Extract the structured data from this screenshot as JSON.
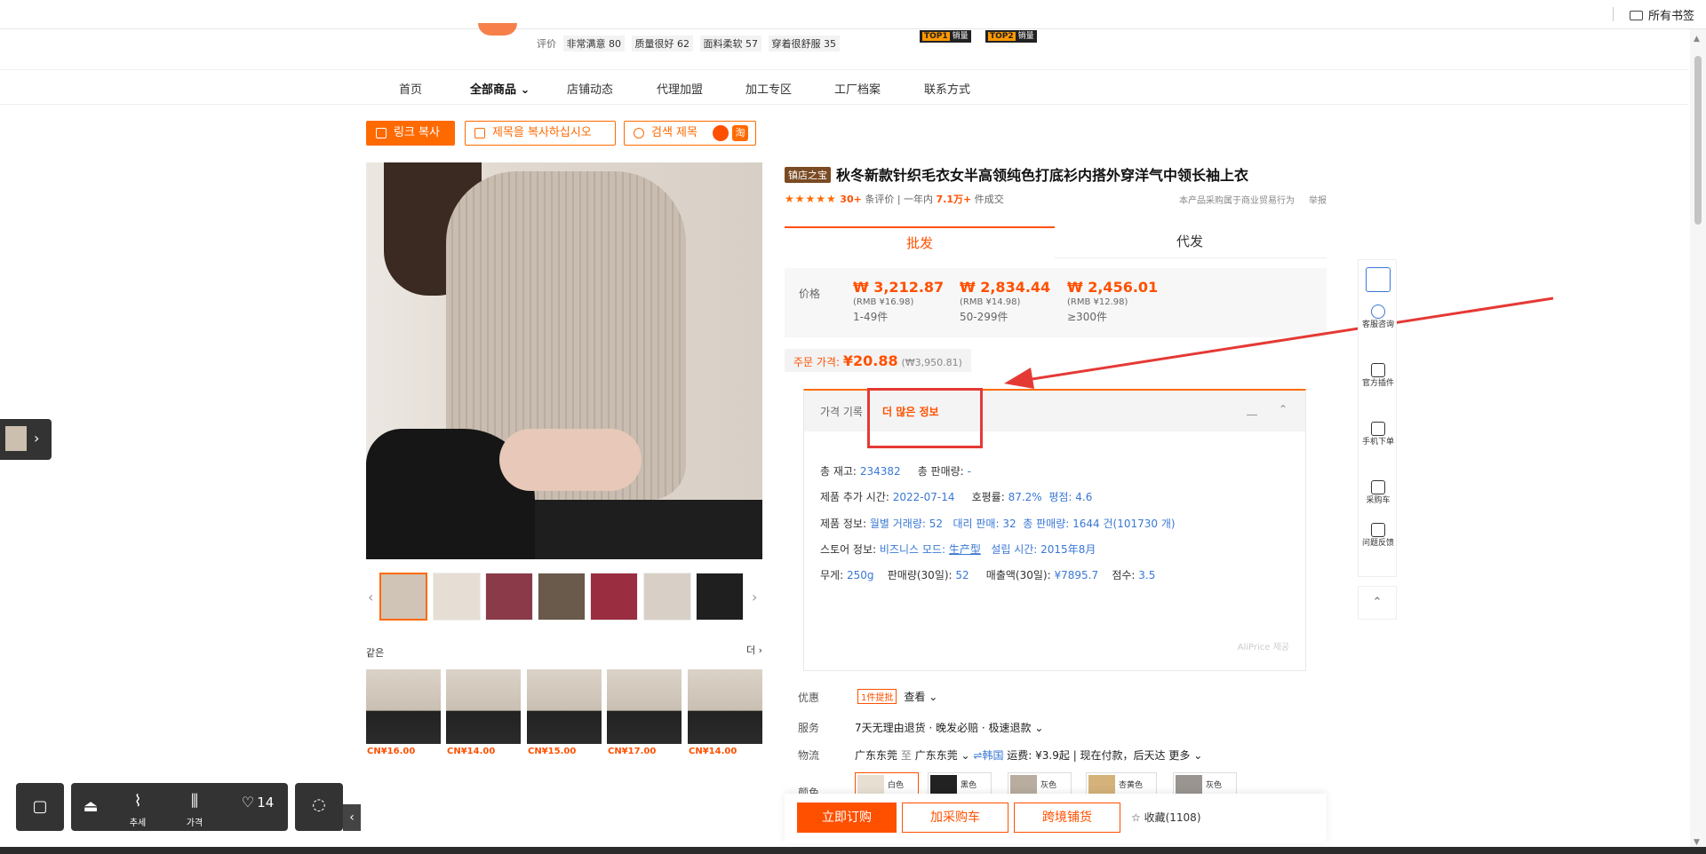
{
  "browser": {
    "bookmarks_label": "所有书签"
  },
  "shop": {
    "rating_label": "评价",
    "rating_tags": [
      "非常满意 80",
      "质量很好 62",
      "面料柔软 57",
      "穿着很舒服 35"
    ],
    "badges": [
      {
        "rank": "TOP1",
        "text": "销量"
      },
      {
        "rank": "TOP2",
        "text": "销量"
      }
    ]
  },
  "nav": {
    "items": [
      "首页",
      "全部商品",
      "店铺动态",
      "代理加盟",
      "加工专区",
      "工厂档案",
      "联系方式"
    ],
    "active": "全部商品"
  },
  "tools": {
    "link_copy": "링크 복사",
    "title_copy": "제목을 복사하십시오",
    "title_search": "검색 제목",
    "taobao_icon_text": "淘"
  },
  "thumbnails": {
    "count": 7,
    "selected_index": 0
  },
  "similar": {
    "heading": "같은",
    "more": "더",
    "prices": [
      "CN¥16.00",
      "CN¥14.00",
      "CN¥15.00",
      "CN¥17.00",
      "CN¥14.00"
    ]
  },
  "product": {
    "badge": "镇店之宝",
    "title": "秋冬新款针织毛衣女半高领纯色打底衫内搭外穿洋气中领长袖上衣",
    "stars": "★★★★★",
    "rating": 4.5,
    "review_count": "30+",
    "review_label": "条评价",
    "sold_prefix": "一年内",
    "sold": "7.1万+",
    "sold_suffix": "件成交",
    "notice": "本产品采购属于商业贸易行为",
    "report": "举报"
  },
  "price_tabs": {
    "wholesale": "批发",
    "dropship": "代发",
    "active": "批发"
  },
  "pricing": {
    "label": "价格",
    "tiers": [
      {
        "price": "₩ 3,212.87",
        "rmb": "(RMB ¥16.98)",
        "qty": "1-49件"
      },
      {
        "price": "₩ 2,834.44",
        "rmb": "(RMB ¥14.98)",
        "qty": "50-299件"
      },
      {
        "price": "₩ 2,456.01",
        "rmb": "(RMB ¥12.98)",
        "qty": "≥300件"
      }
    ],
    "order_label": "주문 가격:",
    "order_price": "¥20.88",
    "order_krw": "(₩3,950.81)"
  },
  "info_panel": {
    "tab_history": "가격 기록",
    "tab_more": "더 많은 정보",
    "rows": {
      "stock_label": "총 재고:",
      "stock": "234382",
      "sales_label": "총 판매량:",
      "sales": "-",
      "added_label": "제품 추가 시간:",
      "added": "2022-07-14",
      "good_label": "호평률:",
      "good": "87.2%",
      "score_label": "평점:",
      "score": "4.6",
      "product_label": "제품 정보:",
      "monthly_label": "월별 거래량:",
      "monthly": "52",
      "agent_label": "대리 판매:",
      "agent": "32",
      "total_label": "총 판매량:",
      "total": "1644 건(101730 개)",
      "store_label": "스토어 정보:",
      "biz_label": "비즈니스 모드:",
      "biz": "生产型",
      "est_label": "설립 시간:",
      "est": "2015年8月",
      "weight_label": "무게:",
      "weight": "250g",
      "sold30_label": "판매량(30일):",
      "sold30": "52",
      "rev30_label": "매출액(30일):",
      "rev30": "¥7895.7",
      "pts_label": "점수:",
      "pts": "3.5"
    },
    "footer": "AliPrice 제공"
  },
  "attributes": {
    "promo_label": "优惠",
    "promo_tag": "1件提批",
    "promo_link": "查看",
    "service_label": "服务",
    "service_text": "7天无理由退货 · 晚发必赔 · 极速退款",
    "logistics_label": "物流",
    "from": "广东东莞",
    "to_word": "至",
    "to": "广东东莞",
    "intl": "⇌韩国",
    "fee": "运费: ¥3.9起",
    "pay": "现在付款，后天达",
    "more": "更多",
    "color_label": "颜色",
    "colors": [
      "白色",
      "黑色",
      "灰色",
      "杏黄色",
      "灰色"
    ]
  },
  "buy_bar": {
    "buy_now": "立即订购",
    "add_cart": "加采购车",
    "cross_border": "跨境铺货",
    "favorite": "收藏(1108)"
  },
  "side_rail": {
    "items": [
      "客服咨询",
      "官方插件",
      "手机下单",
      "采购车",
      "问题反馈"
    ]
  },
  "dock": {
    "trend": "추세",
    "price": "가격",
    "likes": "14"
  },
  "colors": {
    "accent": "#ff5000",
    "annotation_red": "#e53935",
    "link": "#3a78d4"
  }
}
